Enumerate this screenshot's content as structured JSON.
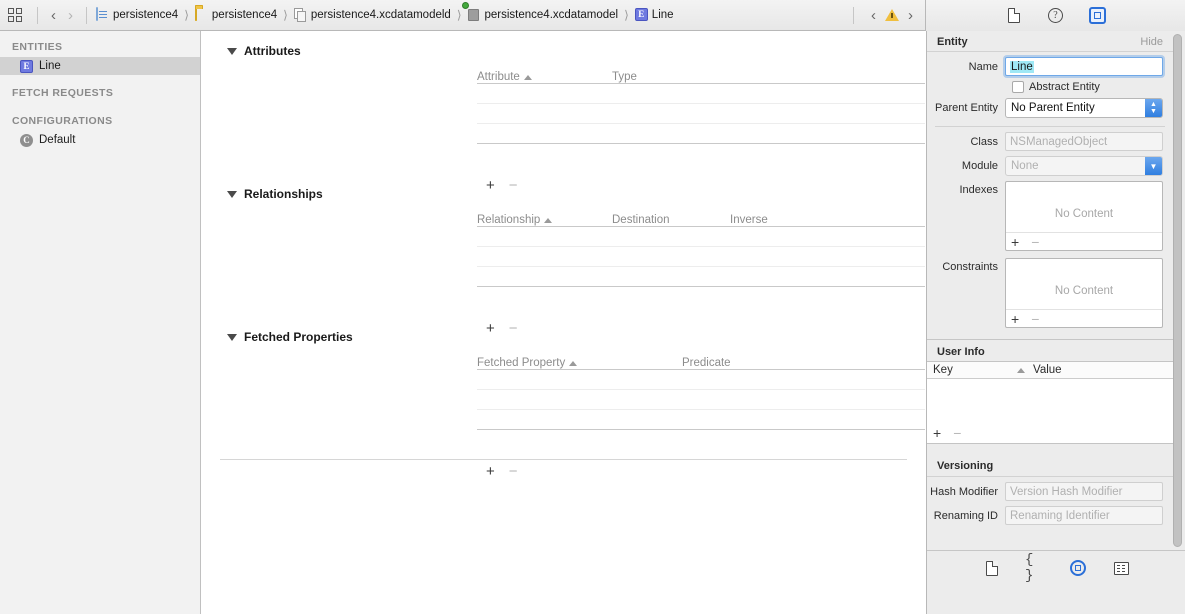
{
  "topbar": {
    "grid_button": "grid-view",
    "back_arrow": "‹",
    "forward_arrow": "›",
    "breadcrumbs": [
      {
        "label": "persistence4",
        "icon": "project-document-icon"
      },
      {
        "label": "persistence4",
        "icon": "folder-icon"
      },
      {
        "label": "persistence4.xcdatamodeld",
        "icon": "datamodel-bundle-icon"
      },
      {
        "label": "persistence4.xcdatamodel",
        "icon": "datamodel-icon"
      },
      {
        "label": "Line",
        "icon": "entity-icon"
      }
    ],
    "issue_prev": "‹",
    "issue_next": "›",
    "warning_icon": "warning-triangle-icon",
    "inspector_tabs": [
      {
        "name": "file-inspector-icon"
      },
      {
        "name": "quick-help-inspector-icon"
      },
      {
        "name": "data-model-inspector-icon",
        "active": true
      }
    ]
  },
  "sidebar": {
    "groups": [
      {
        "header": "ENTITIES",
        "items": [
          {
            "label": "Line",
            "icon": "entity-icon",
            "selected": true
          }
        ]
      },
      {
        "header": "FETCH REQUESTS",
        "items": []
      },
      {
        "header": "CONFIGURATIONS",
        "items": [
          {
            "label": "Default",
            "icon": "configuration-icon",
            "selected": false
          }
        ]
      }
    ]
  },
  "editor": {
    "sections": [
      {
        "title": "Attributes",
        "expanded": true,
        "columns": [
          "Attribute",
          "Type"
        ],
        "sorted_column": 0,
        "rows": [],
        "empty_row_count": 3,
        "add_label": "+",
        "remove_label": "−"
      },
      {
        "title": "Relationships",
        "expanded": true,
        "columns": [
          "Relationship",
          "Destination",
          "Inverse"
        ],
        "sorted_column": 0,
        "rows": [],
        "empty_row_count": 3,
        "add_label": "+",
        "remove_label": "−"
      },
      {
        "title": "Fetched Properties",
        "expanded": true,
        "columns": [
          "Fetched Property",
          "Predicate"
        ],
        "sorted_column": 0,
        "rows": [],
        "empty_row_count": 3,
        "add_label": "+",
        "remove_label": "−"
      }
    ]
  },
  "inspector": {
    "entity": {
      "title": "Entity",
      "hide_label": "Hide",
      "name_label": "Name",
      "name_value": "Line",
      "name_selected": true,
      "abstract_label": "Abstract Entity",
      "abstract_checked": false,
      "parent_label": "Parent Entity",
      "parent_value": "No Parent Entity",
      "class_label": "Class",
      "class_placeholder": "NSManagedObject",
      "module_label": "Module",
      "module_placeholder": "None",
      "indexes_label": "Indexes",
      "indexes_empty": "No Content",
      "constraints_label": "Constraints",
      "constraints_empty": "No Content",
      "add_label": "+",
      "remove_label": "−"
    },
    "user_info": {
      "title": "User Info",
      "columns": [
        "Key",
        "Value"
      ],
      "rows": [],
      "add_label": "+",
      "remove_label": "−"
    },
    "versioning": {
      "title": "Versioning",
      "hash_modifier_label": "Hash Modifier",
      "hash_modifier_placeholder": "Version Hash Modifier",
      "renaming_id_label": "Renaming ID",
      "renaming_id_placeholder": "Renaming Identifier"
    },
    "footer_tabs": [
      {
        "name": "file-template-icon",
        "active": false
      },
      {
        "name": "braces-icon",
        "label": "{ }",
        "active": false
      },
      {
        "name": "target-inspector-icon",
        "active": true
      },
      {
        "name": "list-inspector-icon",
        "active": false
      }
    ]
  },
  "colors": {
    "accent": "#2b6fd8",
    "entity_icon": "#6f7ae0",
    "folder": "#f0c447",
    "selection": "#9fe8f5",
    "warning": "#f0bf3f"
  }
}
